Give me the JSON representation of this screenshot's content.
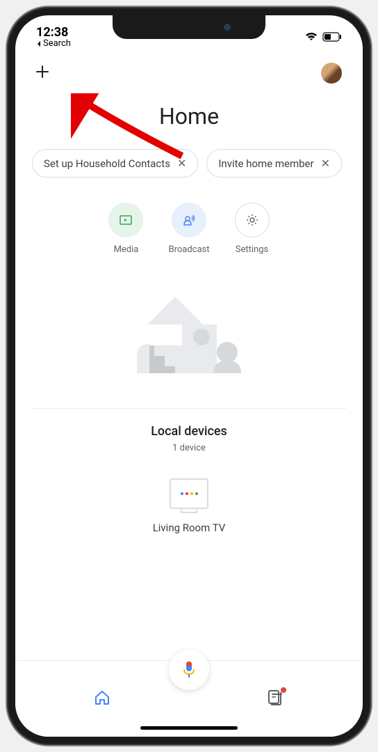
{
  "status": {
    "time": "12:38",
    "back_label": "Search"
  },
  "page_title": "Home",
  "chips": [
    {
      "label": "Set up Household Contacts"
    },
    {
      "label": "Invite home member"
    }
  ],
  "actions": {
    "media": "Media",
    "broadcast": "Broadcast",
    "settings": "Settings"
  },
  "local": {
    "title": "Local devices",
    "count": "1 device"
  },
  "devices": [
    {
      "name": "Living Room TV"
    }
  ],
  "colors": {
    "google_blue": "#4285f4",
    "google_red": "#ea4335",
    "google_yellow": "#fbbc04",
    "google_green": "#34a853"
  }
}
